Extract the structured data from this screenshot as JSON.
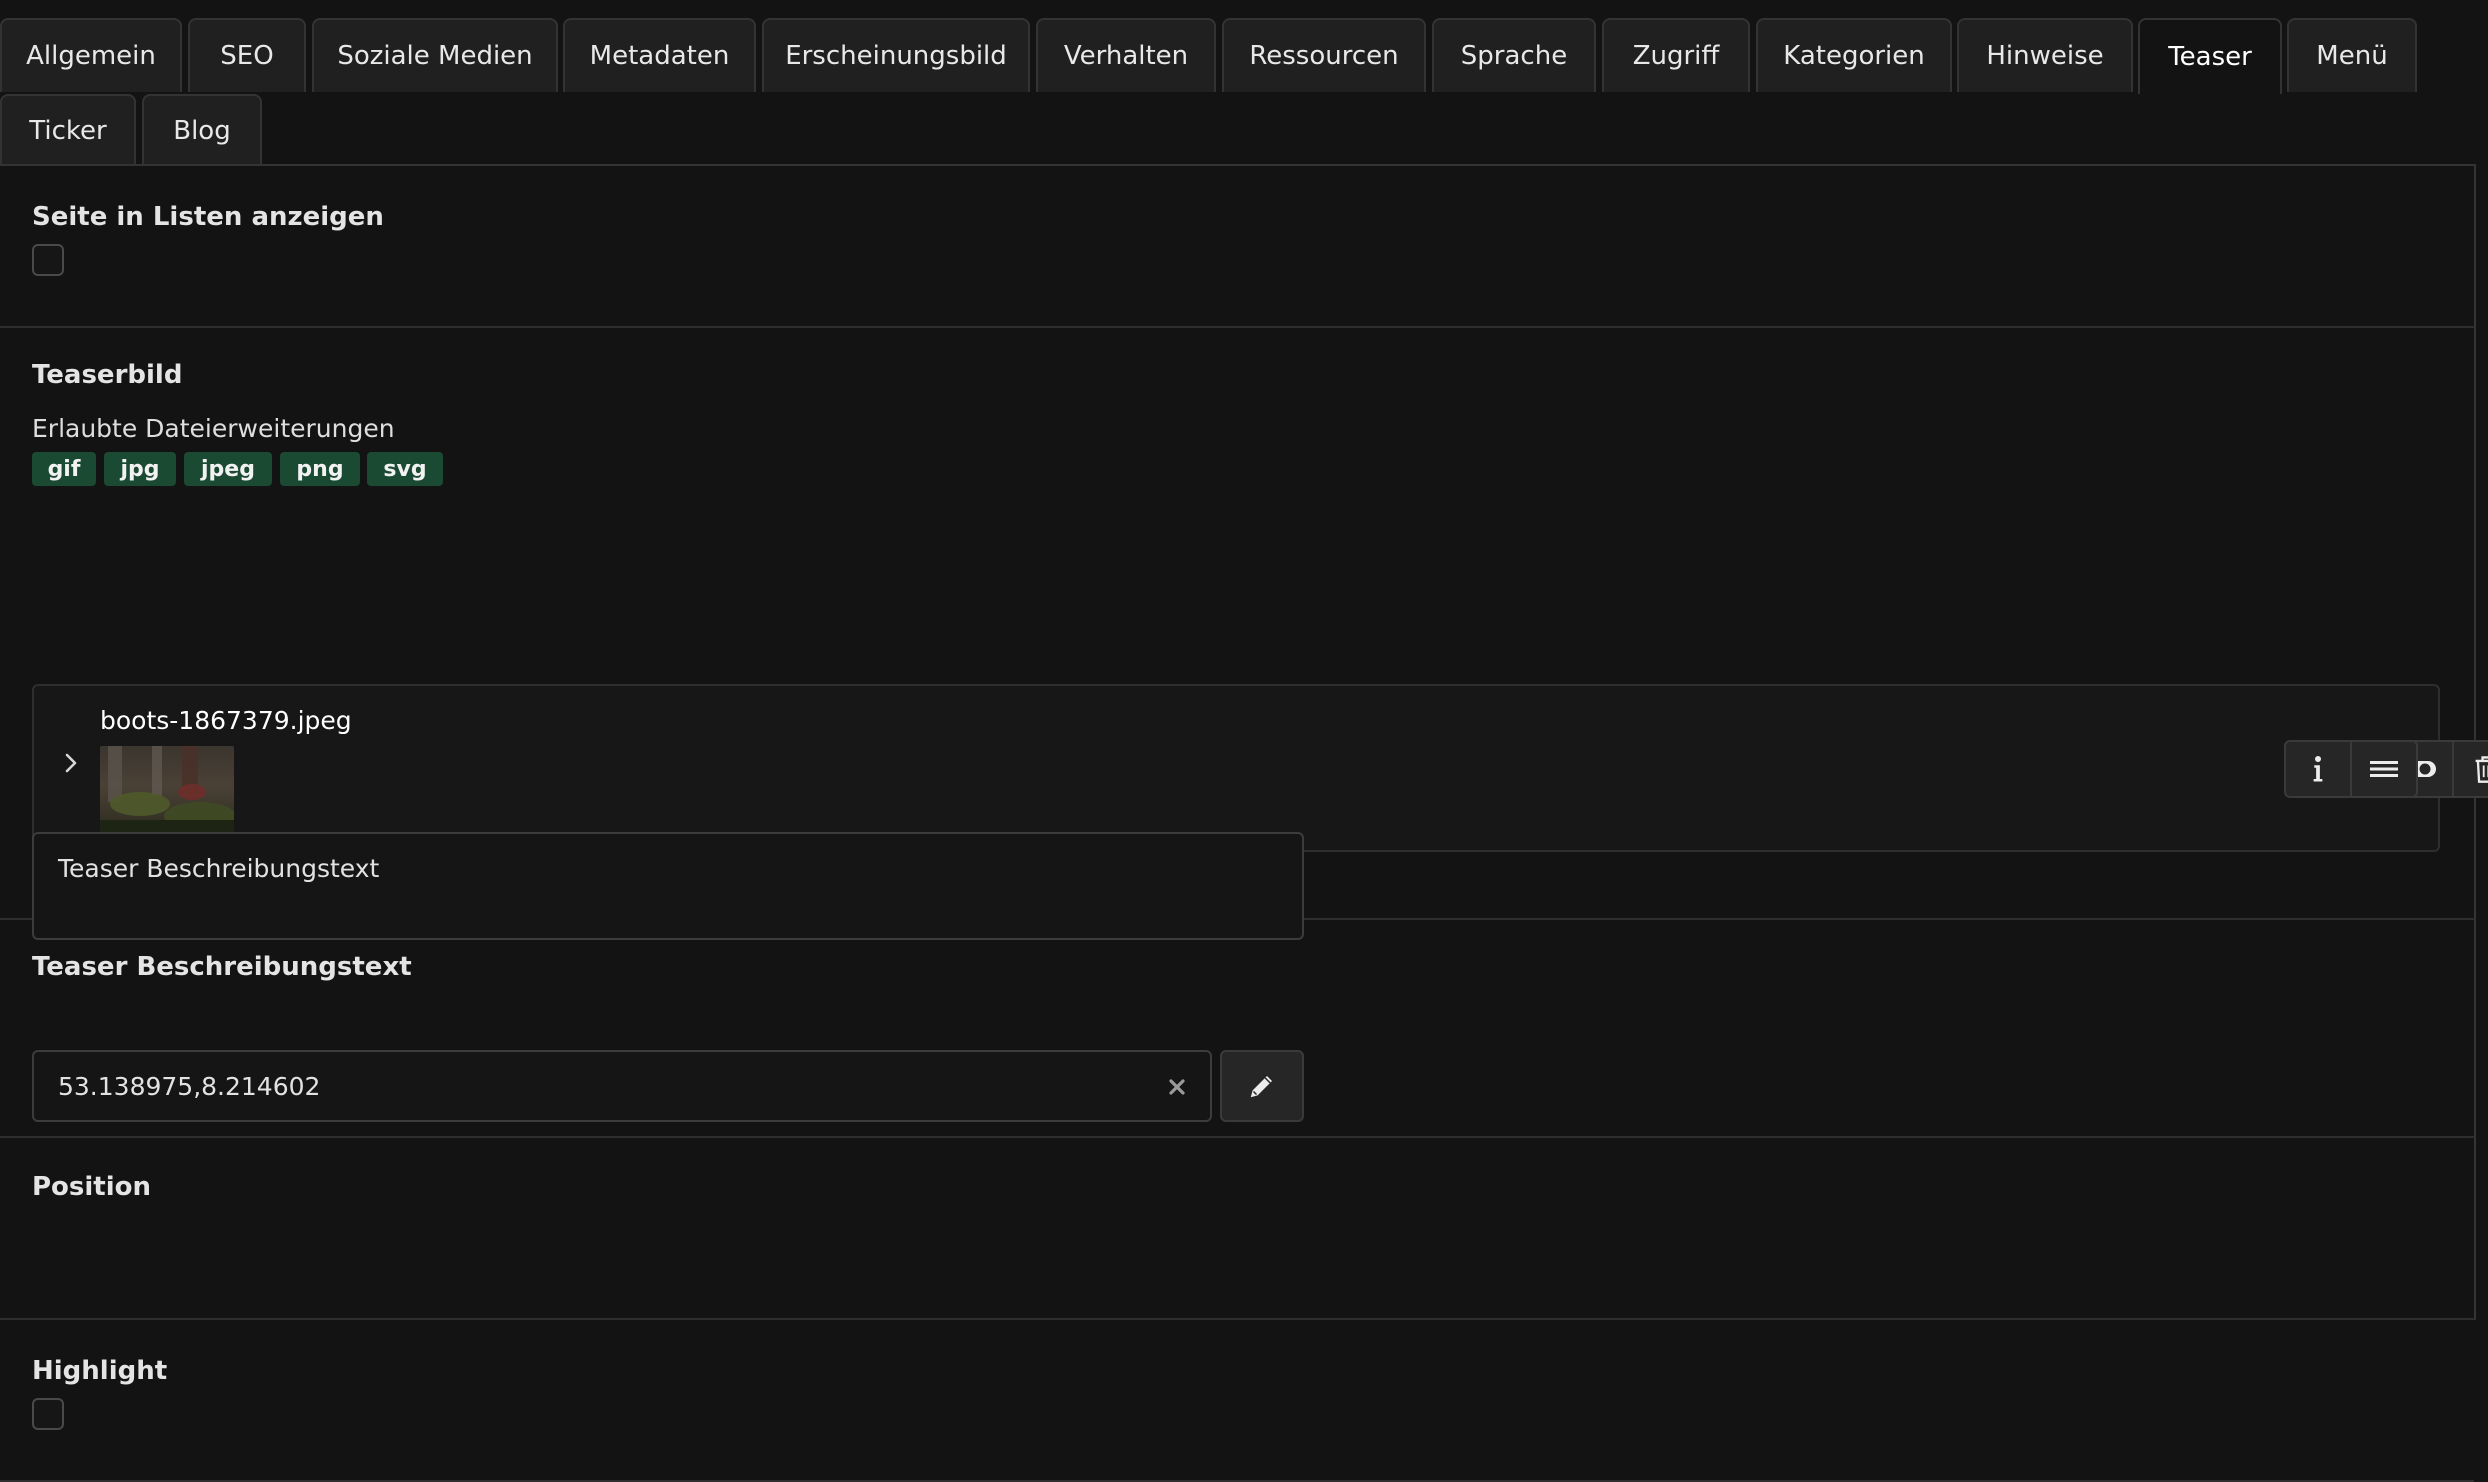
{
  "tabs": [
    {
      "label": "Allgemein",
      "active": false
    },
    {
      "label": "SEO",
      "active": false
    },
    {
      "label": "Soziale Medien",
      "active": false
    },
    {
      "label": "Metadaten",
      "active": false
    },
    {
      "label": "Erscheinungsbild",
      "active": false
    },
    {
      "label": "Verhalten",
      "active": false
    },
    {
      "label": "Ressourcen",
      "active": false
    },
    {
      "label": "Sprache",
      "active": false
    },
    {
      "label": "Zugriff",
      "active": false
    },
    {
      "label": "Kategorien",
      "active": false
    },
    {
      "label": "Hinweise",
      "active": false
    },
    {
      "label": "Teaser",
      "active": true
    },
    {
      "label": "Menü",
      "active": false
    },
    {
      "label": "Ticker",
      "active": false
    },
    {
      "label": "Blog",
      "active": false
    }
  ],
  "show_in_lists": {
    "label": "Seite in Listen anzeigen",
    "checked": false
  },
  "teaser_image": {
    "label": "Teaserbild",
    "allowed_label": "Erlaubte Dateierweiterungen",
    "extensions": [
      "gif",
      "jpg",
      "jpeg",
      "png",
      "svg"
    ],
    "file": {
      "name": "boots-1867379.jpeg",
      "actions": [
        "pencil-icon",
        "toggle-icon",
        "trash-icon",
        "info-icon",
        "drag-handle-icon"
      ]
    }
  },
  "teaser_text": {
    "label": "Teaser Beschreibungstext",
    "value": "Teaser Beschreibungstext"
  },
  "position": {
    "label": "Position",
    "value": "53.138975,8.214602"
  },
  "highlight": {
    "label": "Highlight",
    "checked": false
  },
  "colors": {
    "background": "#131313",
    "badge": "#1b4a33",
    "border": "#333333"
  }
}
